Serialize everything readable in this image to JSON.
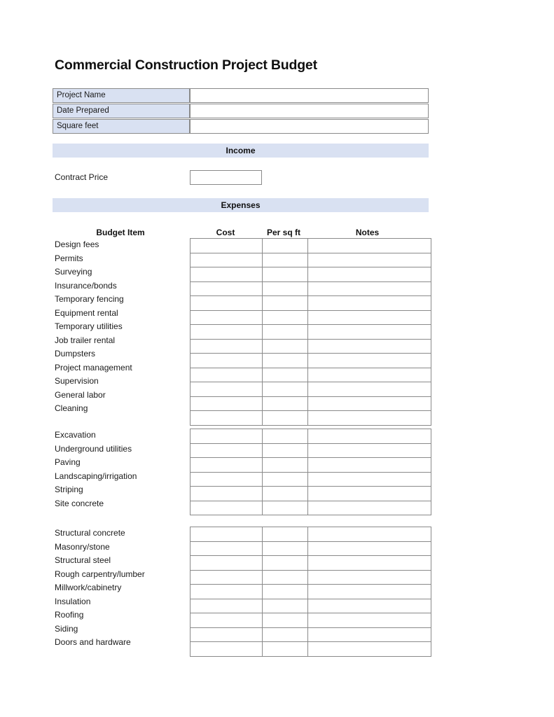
{
  "document": {
    "title": "Commercial Construction Project Budget"
  },
  "project_info": {
    "rows": [
      {
        "label": "Project Name",
        "value": ""
      },
      {
        "label": "Date Prepared",
        "value": ""
      },
      {
        "label": "Square feet",
        "value": ""
      }
    ]
  },
  "sections": {
    "income": {
      "band_label": "Income",
      "contract_price_label": "Contract Price",
      "contract_price_value": ""
    },
    "expenses": {
      "band_label": "Expenses"
    }
  },
  "columns": {
    "budget_item": "Budget Item",
    "cost": "Cost",
    "per_sq_ft": "Per sq ft",
    "notes": "Notes"
  },
  "expense_groups": [
    {
      "items": [
        "Design fees",
        "Permits",
        "Surveying",
        "Insurance/bonds",
        "Temporary fencing",
        "Equipment rental",
        "Temporary utilities",
        "Job trailer rental",
        "Dumpsters",
        "Project management",
        "Supervision",
        "General labor",
        "Cleaning"
      ]
    },
    {
      "items": [
        "Excavation",
        "Underground utilities",
        "Paving",
        "Landscaping/irrigation",
        "Striping",
        "Site concrete"
      ]
    },
    {
      "items": [
        "Structural concrete",
        "Masonry/stone",
        "Structural steel",
        "Rough carpentry/lumber",
        "Millwork/cabinetry",
        "Insulation",
        "Roofing",
        "Siding",
        "Doors and hardware"
      ]
    }
  ],
  "colors": {
    "band_fill": "#d9e1f2",
    "border": "#8a8a8a",
    "text": "#1a1a1a",
    "page_background": "#ffffff"
  },
  "layout": {
    "group_tops": [
      340,
      612,
      752
    ]
  }
}
